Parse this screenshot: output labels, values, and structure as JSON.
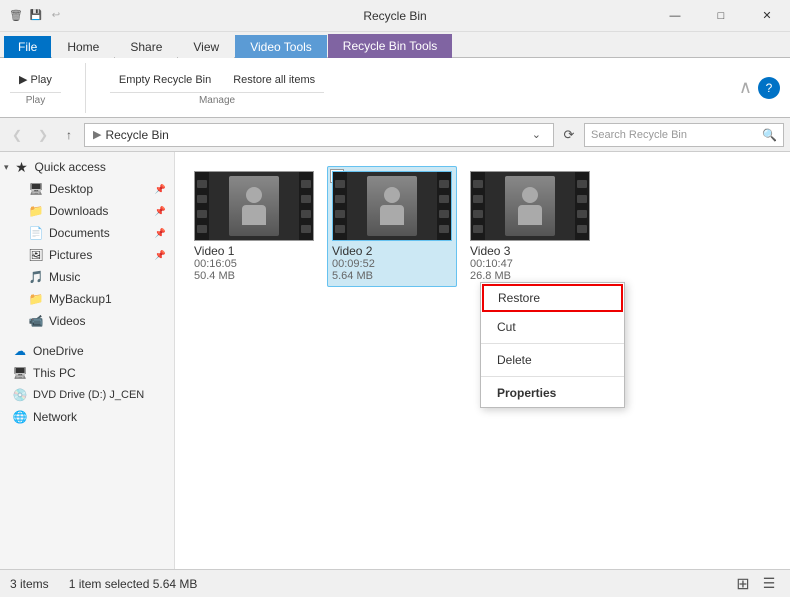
{
  "titlebar": {
    "title": "Recycle Bin",
    "minimize_label": "—",
    "maximize_label": "□",
    "close_label": "✕"
  },
  "ribbon": {
    "tabs": [
      {
        "id": "file",
        "label": "File",
        "type": "file"
      },
      {
        "id": "home",
        "label": "Home",
        "type": "normal"
      },
      {
        "id": "share",
        "label": "Share",
        "type": "normal"
      },
      {
        "id": "view",
        "label": "View",
        "type": "normal"
      },
      {
        "id": "video-tools",
        "label": "Video Tools",
        "type": "colored-blue"
      },
      {
        "id": "recycle-bin-tools",
        "label": "Recycle Bin Tools",
        "type": "colored-purple"
      }
    ],
    "groups": [
      {
        "label": "Play"
      },
      {
        "label": "Manage"
      }
    ]
  },
  "addressbar": {
    "back_label": "❮",
    "forward_label": "❯",
    "up_label": "↑",
    "path": "Recycle Bin",
    "search_placeholder": "Search Recycle Bin",
    "refresh_label": "⟳"
  },
  "sidebar": {
    "sections": [
      {
        "items": [
          {
            "id": "quick-access",
            "label": "Quick access",
            "icon": "★",
            "type": "header",
            "pinned": false
          },
          {
            "id": "desktop",
            "label": "Desktop",
            "icon": "🖥",
            "pinned": true
          },
          {
            "id": "downloads",
            "label": "Downloads",
            "icon": "📁",
            "pinned": true
          },
          {
            "id": "documents",
            "label": "Documents",
            "icon": "📄",
            "pinned": true
          },
          {
            "id": "pictures",
            "label": "Pictures",
            "icon": "🖼",
            "pinned": true
          },
          {
            "id": "music",
            "label": "Music",
            "icon": "🎵",
            "pinned": false
          },
          {
            "id": "mybackup1",
            "label": "MyBackup1",
            "icon": "📁",
            "pinned": false
          },
          {
            "id": "videos",
            "label": "Videos",
            "icon": "📹",
            "pinned": false
          }
        ]
      },
      {
        "items": [
          {
            "id": "onedrive",
            "label": "OneDrive",
            "icon": "☁",
            "type": "normal"
          },
          {
            "id": "this-pc",
            "label": "This PC",
            "icon": "💻",
            "type": "normal"
          },
          {
            "id": "dvd-drive",
            "label": "DVD Drive (D:) J_CEN",
            "icon": "💿",
            "type": "normal"
          },
          {
            "id": "network",
            "label": "Network",
            "icon": "🌐",
            "type": "normal"
          }
        ]
      }
    ]
  },
  "files": [
    {
      "id": "video1",
      "name": "Video 1",
      "duration": "00:16:05",
      "size": "50.4 MB",
      "selected": false,
      "checked": false
    },
    {
      "id": "video2",
      "name": "Video 2",
      "duration": "00:09:52",
      "size": "5.64 MB",
      "selected": true,
      "checked": true
    },
    {
      "id": "video3",
      "name": "Video 3",
      "duration": "00:10:47",
      "size": "26.8 MB",
      "selected": false,
      "checked": false
    }
  ],
  "context_menu": {
    "items": [
      {
        "id": "restore",
        "label": "Restore",
        "type": "restore"
      },
      {
        "id": "cut",
        "label": "Cut",
        "type": "normal"
      },
      {
        "id": "delete",
        "label": "Delete",
        "type": "normal"
      },
      {
        "id": "properties",
        "label": "Properties",
        "type": "bold"
      }
    ]
  },
  "statusbar": {
    "item_count": "3 items",
    "selection_info": "1 item selected  5.64 MB",
    "view_icons": [
      "⊞",
      "☰"
    ]
  }
}
